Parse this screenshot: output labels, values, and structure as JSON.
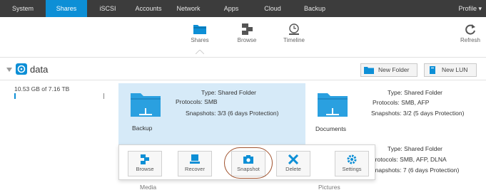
{
  "nav": {
    "items": [
      {
        "label": "System",
        "active": false
      },
      {
        "label": "Shares",
        "active": true
      },
      {
        "label": "iSCSI",
        "active": false
      },
      {
        "label": "Accounts",
        "active": false
      },
      {
        "label": "Network",
        "active": false
      },
      {
        "label": "Apps",
        "active": false
      },
      {
        "label": "Cloud",
        "active": false
      },
      {
        "label": "Backup",
        "active": false
      }
    ],
    "profile": "Profile ▾"
  },
  "toolbar": {
    "shares": "Shares",
    "browse": "Browse",
    "timeline": "Timeline",
    "refresh": "Refresh"
  },
  "volume": {
    "name": "data",
    "usage": "10.53 GB of 7.16 TB",
    "usage_fraction": 0.0014
  },
  "header_buttons": {
    "new_folder": "New Folder",
    "new_lun": "New LUN"
  },
  "shares": [
    {
      "name": "Backup",
      "type": "Type: Shared Folder",
      "protocols": "Protocols: SMB",
      "snapshots": "Snapshots: 3/3 (6 days Protection)"
    },
    {
      "name": "Documents",
      "type": "Type: Shared Folder",
      "protocols": "Protocols: SMB, AFP",
      "snapshots": "Snapshots: 3/2 (5 days Protection)"
    },
    {
      "name": "Media",
      "type": "Type: Shared Folder",
      "protocols": "Protocols: SMB, AFP, DLNA",
      "snapshots": "Snapshots: 7 (6 days Protection)"
    },
    {
      "name": "Pictures",
      "type": "",
      "protocols": "",
      "snapshots": ""
    }
  ],
  "context_menu": {
    "browse": "Browse",
    "recover": "Recover",
    "snapshot": "Snapshot",
    "delete": "Delete",
    "settings": "Settings"
  },
  "colors": {
    "accent": "#0d8fd6",
    "nav_bg": "#3c3c3c",
    "selected_bg": "#d6eaf8",
    "folder": "#2aa0e0",
    "highlight_ring": "#a0522d"
  }
}
